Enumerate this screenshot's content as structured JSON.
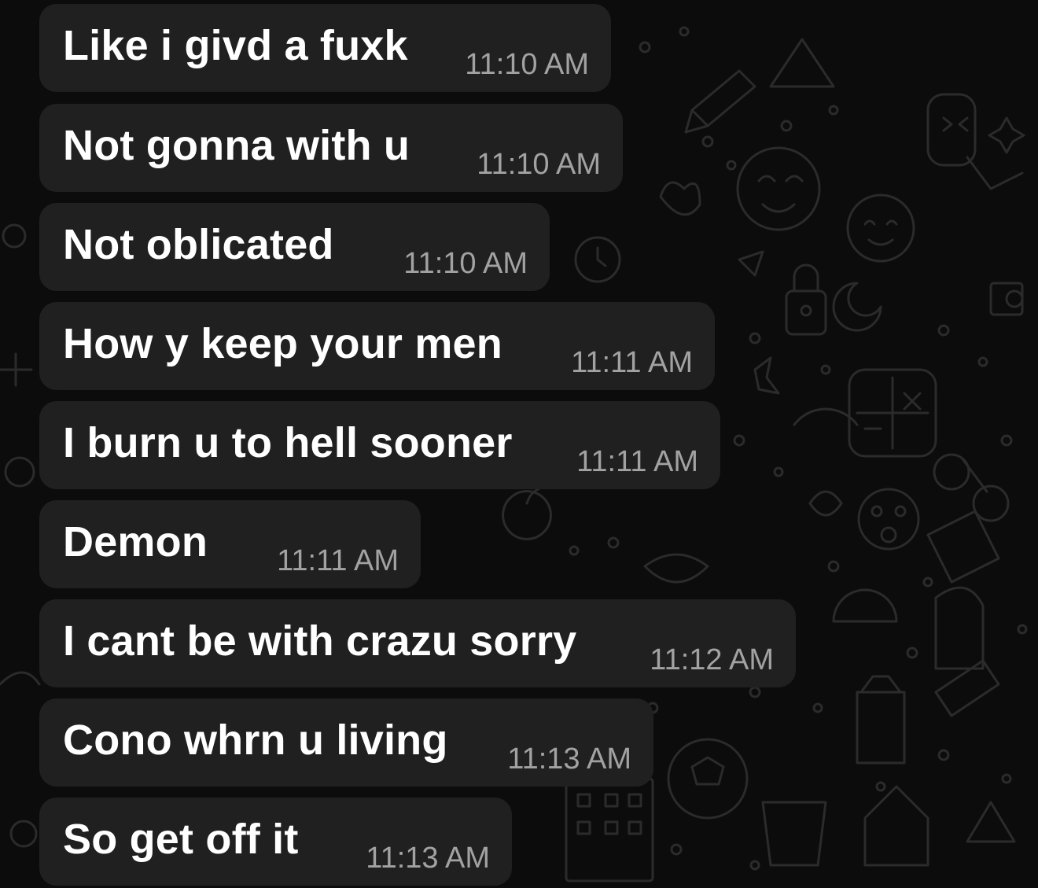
{
  "messages": [
    {
      "text": "Like i givd a fuxk",
      "time": "11:10 AM"
    },
    {
      "text": "Not gonna with u",
      "time": "11:10 AM"
    },
    {
      "text": "Not oblicated",
      "time": "11:10 AM"
    },
    {
      "text": "How y keep your men",
      "time": "11:11 AM"
    },
    {
      "text": "I burn u to hell sooner",
      "time": "11:11 AM"
    },
    {
      "text": "Demon",
      "time": "11:11 AM"
    },
    {
      "text": "I cant be with crazu sorry",
      "time": "11:12 AM"
    },
    {
      "text": "Cono whrn u living",
      "time": "11:13 AM"
    },
    {
      "text": "So get off it",
      "time": "11:13 AM"
    }
  ],
  "colors": {
    "background": "#0c0c0c",
    "bubble": "#202020",
    "text": "#ffffff",
    "timestamp": "#a2a2a2",
    "doodle": "#2a2a2a"
  },
  "icons": [
    "wallpaper-doodle-pattern"
  ]
}
